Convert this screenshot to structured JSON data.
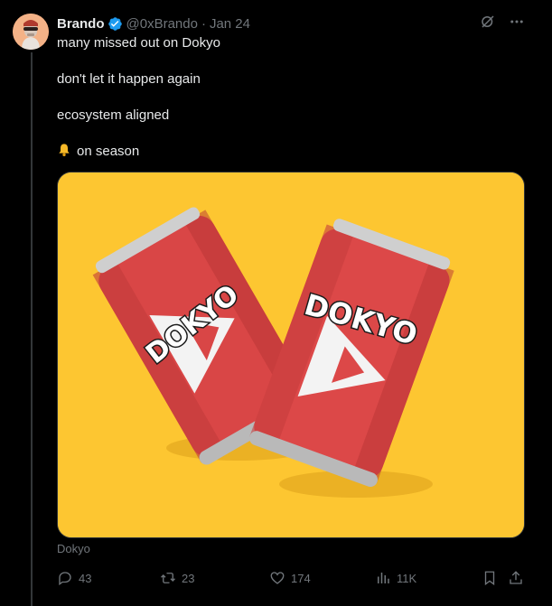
{
  "tweet": {
    "author_name": "Brando",
    "handle": "@0xBrando",
    "separator": "·",
    "date": "Jan 24",
    "lines": [
      "many missed out on Dokyo",
      "don't let it happen again",
      "ecosystem aligned",
      "on season"
    ],
    "media": {
      "can_left_label": "DOKYO",
      "can_right_label": "DOKYO",
      "background_color": "#fdc631",
      "can_color": "#d94646"
    },
    "media_caption": "Dokyo",
    "actions": {
      "replies": "43",
      "reposts": "23",
      "likes": "174",
      "views": "11K"
    }
  },
  "icons": {
    "verified": "verified-badge-icon",
    "grok": "grok-icon",
    "more": "more-icon",
    "bell": "bell-icon",
    "reply": "reply-icon",
    "repost": "repost-icon",
    "like": "heart-icon",
    "views": "views-icon",
    "bookmark": "bookmark-icon",
    "share": "share-icon"
  },
  "colors": {
    "background": "#000000",
    "text": "#e7e9ea",
    "muted": "#71767b",
    "verified": "#1d9bf0"
  }
}
